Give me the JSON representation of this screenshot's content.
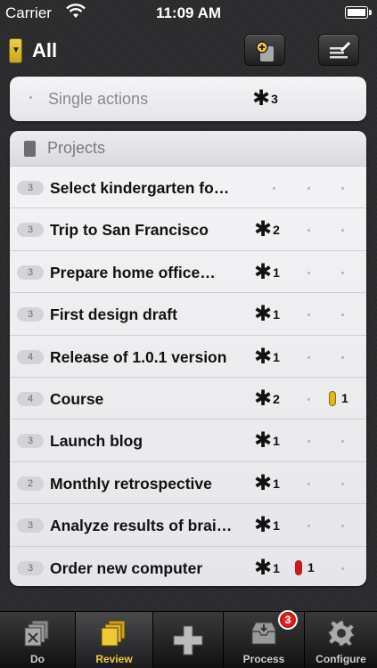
{
  "status_bar": {
    "carrier": "Carrier",
    "time": "11:09 AM"
  },
  "nav": {
    "title": "All"
  },
  "single_actions": {
    "label": "Single actions",
    "star_count": "3"
  },
  "projects": {
    "header": "Projects",
    "rows": [
      {
        "num": "3",
        "title": "Select kindergarten fo…",
        "stars": "",
        "flag": "",
        "flag_count": ""
      },
      {
        "num": "3",
        "title": "Trip to San Francisco",
        "stars": "2",
        "flag": "",
        "flag_count": ""
      },
      {
        "num": "3",
        "title": "Prepare home office…",
        "stars": "1",
        "flag": "",
        "flag_count": ""
      },
      {
        "num": "3",
        "title": "First design draft",
        "stars": "1",
        "flag": "",
        "flag_count": ""
      },
      {
        "num": "4",
        "title": "Release of 1.0.1 version",
        "stars": "1",
        "flag": "",
        "flag_count": ""
      },
      {
        "num": "4",
        "title": "Course",
        "stars": "2",
        "flag": "yellow",
        "flag_count": "1"
      },
      {
        "num": "3",
        "title": "Launch blog",
        "stars": "1",
        "flag": "",
        "flag_count": ""
      },
      {
        "num": "2",
        "title": "Monthly retrospective",
        "stars": "1",
        "flag": "",
        "flag_count": ""
      },
      {
        "num": "3",
        "title": "Analyze results of brai…",
        "stars": "1",
        "flag": "",
        "flag_count": ""
      },
      {
        "num": "3",
        "title": "Order new computer",
        "stars": "1",
        "flag": "red",
        "flag_count": "1"
      }
    ]
  },
  "tabs": [
    {
      "label": "Do",
      "icon": "do-icon"
    },
    {
      "label": "Review",
      "icon": "review-icon"
    },
    {
      "label": "",
      "icon": "add-icon"
    },
    {
      "label": "Process",
      "icon": "process-icon",
      "badge": "3"
    },
    {
      "label": "Configure",
      "icon": "gear-icon"
    }
  ],
  "colors": {
    "accent": "#f0c93a",
    "flag_yellow": "#e0b81a",
    "flag_red": "#d01818"
  }
}
